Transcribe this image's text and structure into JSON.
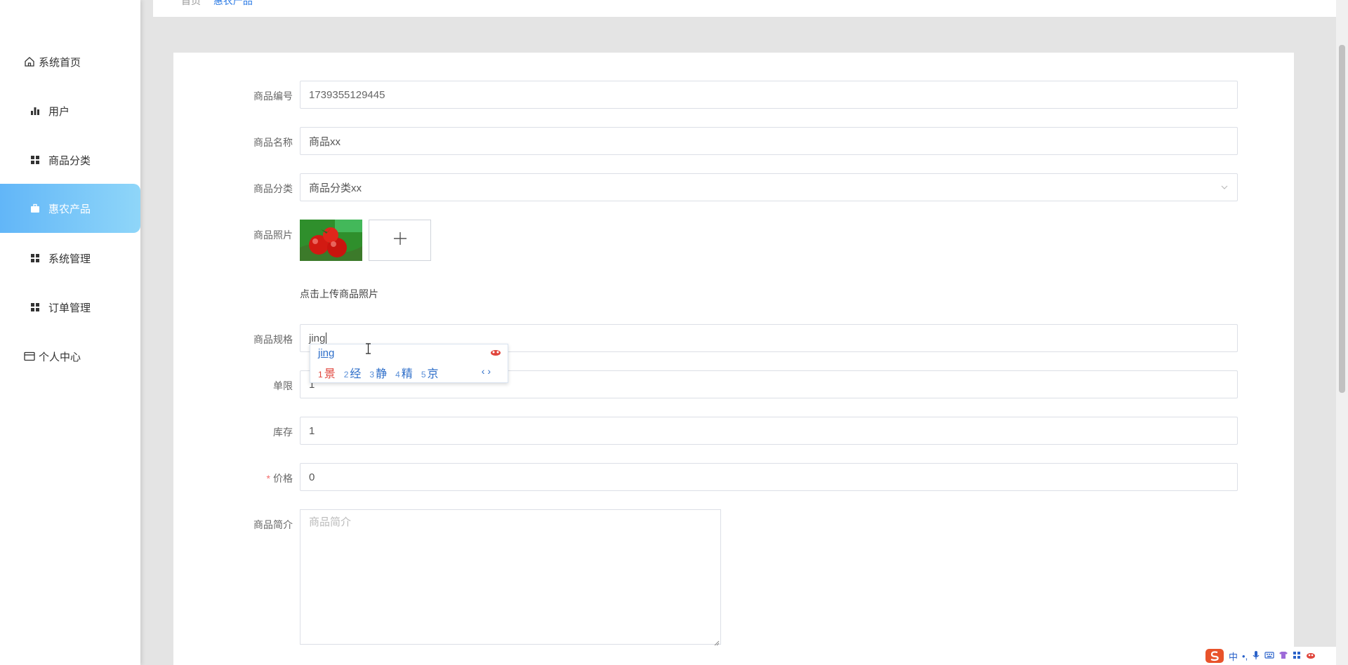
{
  "sidebar": {
    "items": [
      {
        "label": "系统首页",
        "icon": "home-icon"
      },
      {
        "label": "用户",
        "icon": "bar-chart-icon"
      },
      {
        "label": "商品分类",
        "icon": "grid-icon"
      },
      {
        "label": "惠农产品",
        "icon": "briefcase-icon",
        "active": true
      },
      {
        "label": "系统管理",
        "icon": "grid-icon"
      },
      {
        "label": "订单管理",
        "icon": "grid-icon"
      },
      {
        "label": "个人中心",
        "icon": "card-icon"
      }
    ]
  },
  "breadcrumb": {
    "home": "首页",
    "current": "惠农产品"
  },
  "form": {
    "code": {
      "label": "商品编号",
      "value": "1739355129445"
    },
    "name": {
      "label": "商品名称",
      "value": "商品xx"
    },
    "category": {
      "label": "商品分类",
      "value": "商品分类xx"
    },
    "photo": {
      "label": "商品照片",
      "hint": "点击上传商品照片"
    },
    "spec": {
      "label": "商品规格",
      "value": "jing"
    },
    "limit": {
      "label": "单限",
      "value": "1"
    },
    "stock": {
      "label": "库存",
      "value": "1"
    },
    "price": {
      "label": "价格",
      "required_mark": "*",
      "value": "0"
    },
    "intro": {
      "label": "商品简介",
      "placeholder": "商品简介"
    }
  },
  "ime": {
    "pinyin": "jing",
    "candidates": [
      {
        "n": "1",
        "text": "景"
      },
      {
        "n": "2",
        "text": "经"
      },
      {
        "n": "3",
        "text": "静"
      },
      {
        "n": "4",
        "text": "精"
      },
      {
        "n": "5",
        "text": "京"
      }
    ],
    "pager": "‹ ›"
  },
  "tray": {
    "lang": "中",
    "punct": "•,"
  },
  "colors": {
    "accent": "#62b6f8",
    "link": "#2c7be5",
    "required": "#f56c6c"
  }
}
